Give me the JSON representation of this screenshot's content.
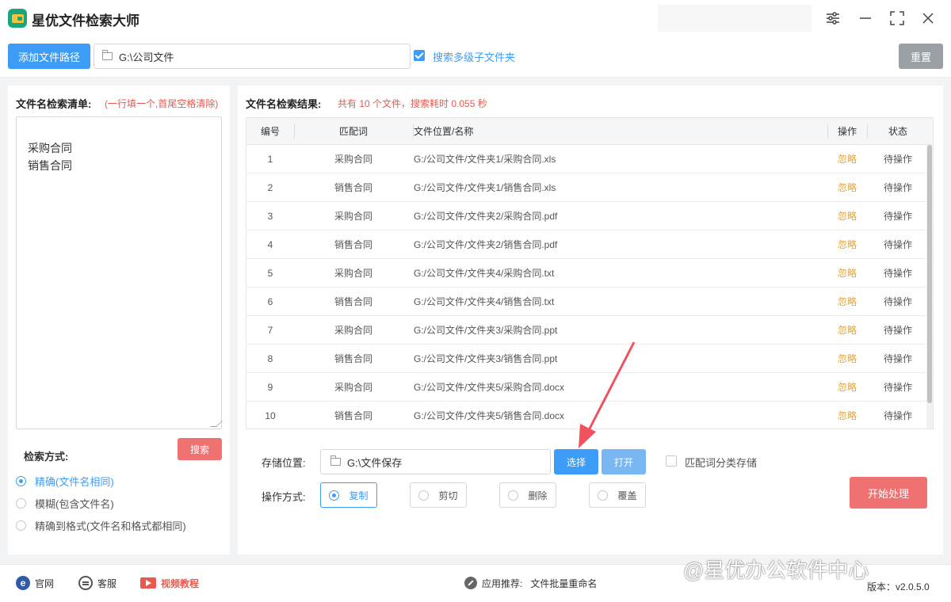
{
  "app": {
    "title": "星优文件检索大师"
  },
  "toolbar": {
    "add_path_label": "添加文件路径",
    "path_value": "G:\\公司文件",
    "subfolder_label": "搜索多级子文件夹",
    "subfolder_checked": true,
    "reset_label": "重置"
  },
  "left": {
    "title": "文件名检索清单:",
    "hint": "(一行填一个,首尾空格清除)",
    "keywords": "采购合同\n销售合同",
    "search_mode_label": "检索方式:",
    "search_button": "搜索",
    "modes": [
      {
        "label": "精确(文件名相同)",
        "selected": true
      },
      {
        "label": "模糊(包含文件名)",
        "selected": false
      },
      {
        "label": "精确到格式(文件名和格式都相同)",
        "selected": false
      }
    ]
  },
  "results": {
    "title": "文件名检索结果:",
    "summary": "共有 10 个文件，搜索耗时 0.055 秒",
    "columns": [
      "编号",
      "匹配词",
      "文件位置/名称",
      "操作",
      "状态"
    ],
    "rows": [
      {
        "num": "1",
        "keyword": "采购合同",
        "path": "G:/公司文件/文件夹1/采购合同.xls",
        "op": "忽略",
        "status": "待操作"
      },
      {
        "num": "2",
        "keyword": "销售合同",
        "path": "G:/公司文件/文件夹1/销售合同.xls",
        "op": "忽略",
        "status": "待操作"
      },
      {
        "num": "3",
        "keyword": "采购合同",
        "path": "G:/公司文件/文件夹2/采购合同.pdf",
        "op": "忽略",
        "status": "待操作"
      },
      {
        "num": "4",
        "keyword": "销售合同",
        "path": "G:/公司文件/文件夹2/销售合同.pdf",
        "op": "忽略",
        "status": "待操作"
      },
      {
        "num": "5",
        "keyword": "采购合同",
        "path": "G:/公司文件/文件夹4/采购合同.txt",
        "op": "忽略",
        "status": "待操作"
      },
      {
        "num": "6",
        "keyword": "销售合同",
        "path": "G:/公司文件/文件夹4/销售合同.txt",
        "op": "忽略",
        "status": "待操作"
      },
      {
        "num": "7",
        "keyword": "采购合同",
        "path": "G:/公司文件/文件夹3/采购合同.ppt",
        "op": "忽略",
        "status": "待操作"
      },
      {
        "num": "8",
        "keyword": "销售合同",
        "path": "G:/公司文件/文件夹3/销售合同.ppt",
        "op": "忽略",
        "status": "待操作"
      },
      {
        "num": "9",
        "keyword": "采购合同",
        "path": "G:/公司文件/文件夹5/采购合同.docx",
        "op": "忽略",
        "status": "待操作"
      },
      {
        "num": "10",
        "keyword": "销售合同",
        "path": "G:/公司文件/文件夹5/销售合同.docx",
        "op": "忽略",
        "status": "待操作"
      }
    ]
  },
  "output": {
    "save_label": "存储位置:",
    "save_path": "G:\\文件保存",
    "choose_label": "选择",
    "open_label": "打开",
    "category_label": "匹配词分类存储",
    "category_checked": false,
    "op_label": "操作方式:",
    "ops": [
      {
        "label": "复制",
        "selected": true
      },
      {
        "label": "剪切",
        "selected": false
      },
      {
        "label": "删除",
        "selected": false
      },
      {
        "label": "覆盖",
        "selected": false
      }
    ],
    "start_label": "开始处理"
  },
  "footer": {
    "website": "官网",
    "service": "客服",
    "video": "视频教程",
    "recommend_label": "应用推荐:",
    "recommend_app": "文件批量重命名",
    "version": "版本：v2.0.5.0"
  },
  "watermark": "@星优办公软件中心",
  "colors": {
    "primary": "#3d9cf5",
    "danger": "#f07171",
    "warning_link": "#e2a23b",
    "hint_red": "#e9574f"
  }
}
